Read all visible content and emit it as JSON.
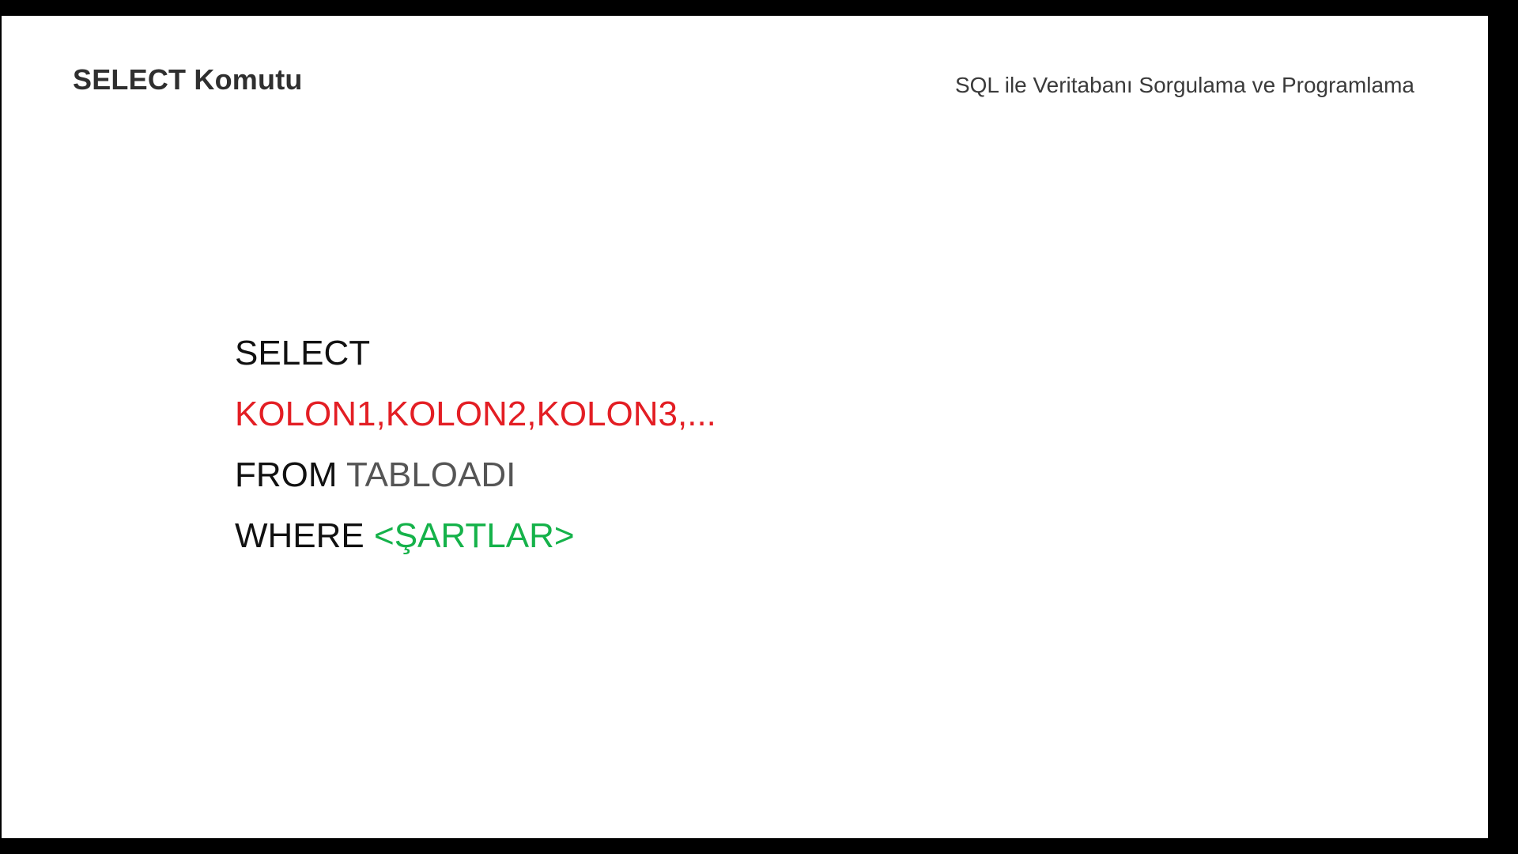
{
  "slide": {
    "title": "SELECT Komutu",
    "course_title": "SQL ile Veritabanı Sorgulama ve Programlama"
  },
  "code": {
    "line1_keyword": "SELECT",
    "line2_columns": "KOLON1,KOLON2,KOLON3,...",
    "line3_keyword": "FROM",
    "line3_table": "TABLOADI",
    "line4_keyword": "WHERE",
    "line4_conditions": "<ŞARTLAR>"
  },
  "colors": {
    "columns": "#e31e24",
    "table": "#555555",
    "conditions": "#15b24a",
    "keyword": "#111111",
    "background": "#ffffff",
    "letterbox": "#000000"
  }
}
